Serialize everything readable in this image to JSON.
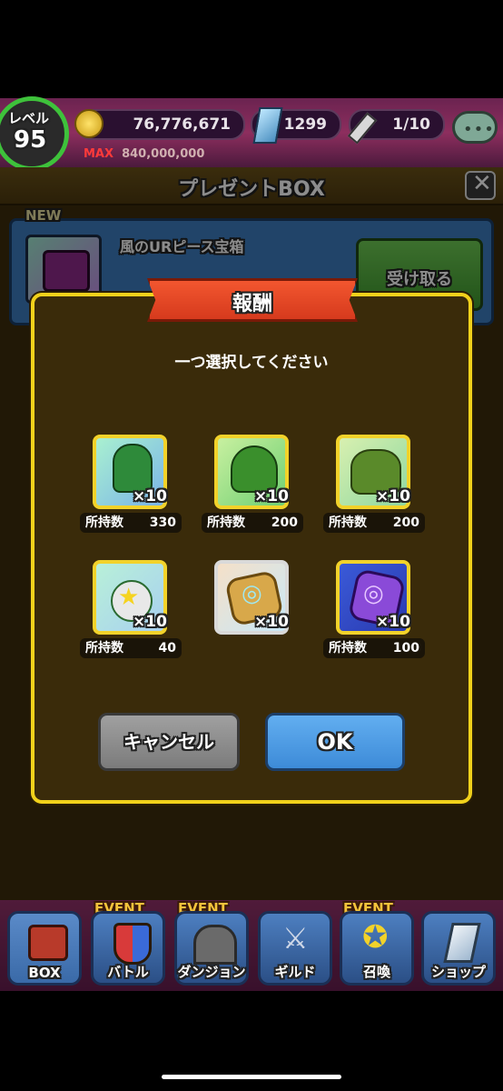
{
  "status": {
    "level_label": "レベル",
    "level_value": "95",
    "coins": "76,776,671",
    "coins_max_label": "MAX",
    "coins_max": "840,000,000",
    "gems": "1299",
    "stamina": "1/10"
  },
  "panel": {
    "title": "プレゼントBOX",
    "new_badge": "NEW",
    "present_name": "風のURピース宝箱",
    "receive_label": "受け取る"
  },
  "dialog": {
    "title": "報酬",
    "prompt": "一つ選択してください",
    "count_label": "所持数",
    "items": [
      {
        "qty": "×10",
        "count": "330",
        "icon": "green-mummy-icon"
      },
      {
        "qty": "×10",
        "count": "200",
        "icon": "green-dragon-icon"
      },
      {
        "qty": "×10",
        "count": "200",
        "icon": "green-beast-icon"
      },
      {
        "qty": "×10",
        "count": "40",
        "icon": "star-robot-icon"
      },
      {
        "qty": "×10",
        "count": "",
        "icon": "gold-spiral-crystal-icon"
      },
      {
        "qty": "×10",
        "count": "100",
        "icon": "purple-spiral-crystal-icon"
      }
    ],
    "cancel_label": "キャンセル",
    "ok_label": "OK"
  },
  "nav": {
    "event_label": "EVENT",
    "items": [
      "BOX",
      "バトル",
      "ダンジョン",
      "ギルド",
      "召喚",
      "ショップ"
    ]
  },
  "colors": {
    "dialog_border": "#f1d11b",
    "ok": "#4f9be6",
    "cancel": "#8b8b8b",
    "banner": "#e8412b"
  }
}
